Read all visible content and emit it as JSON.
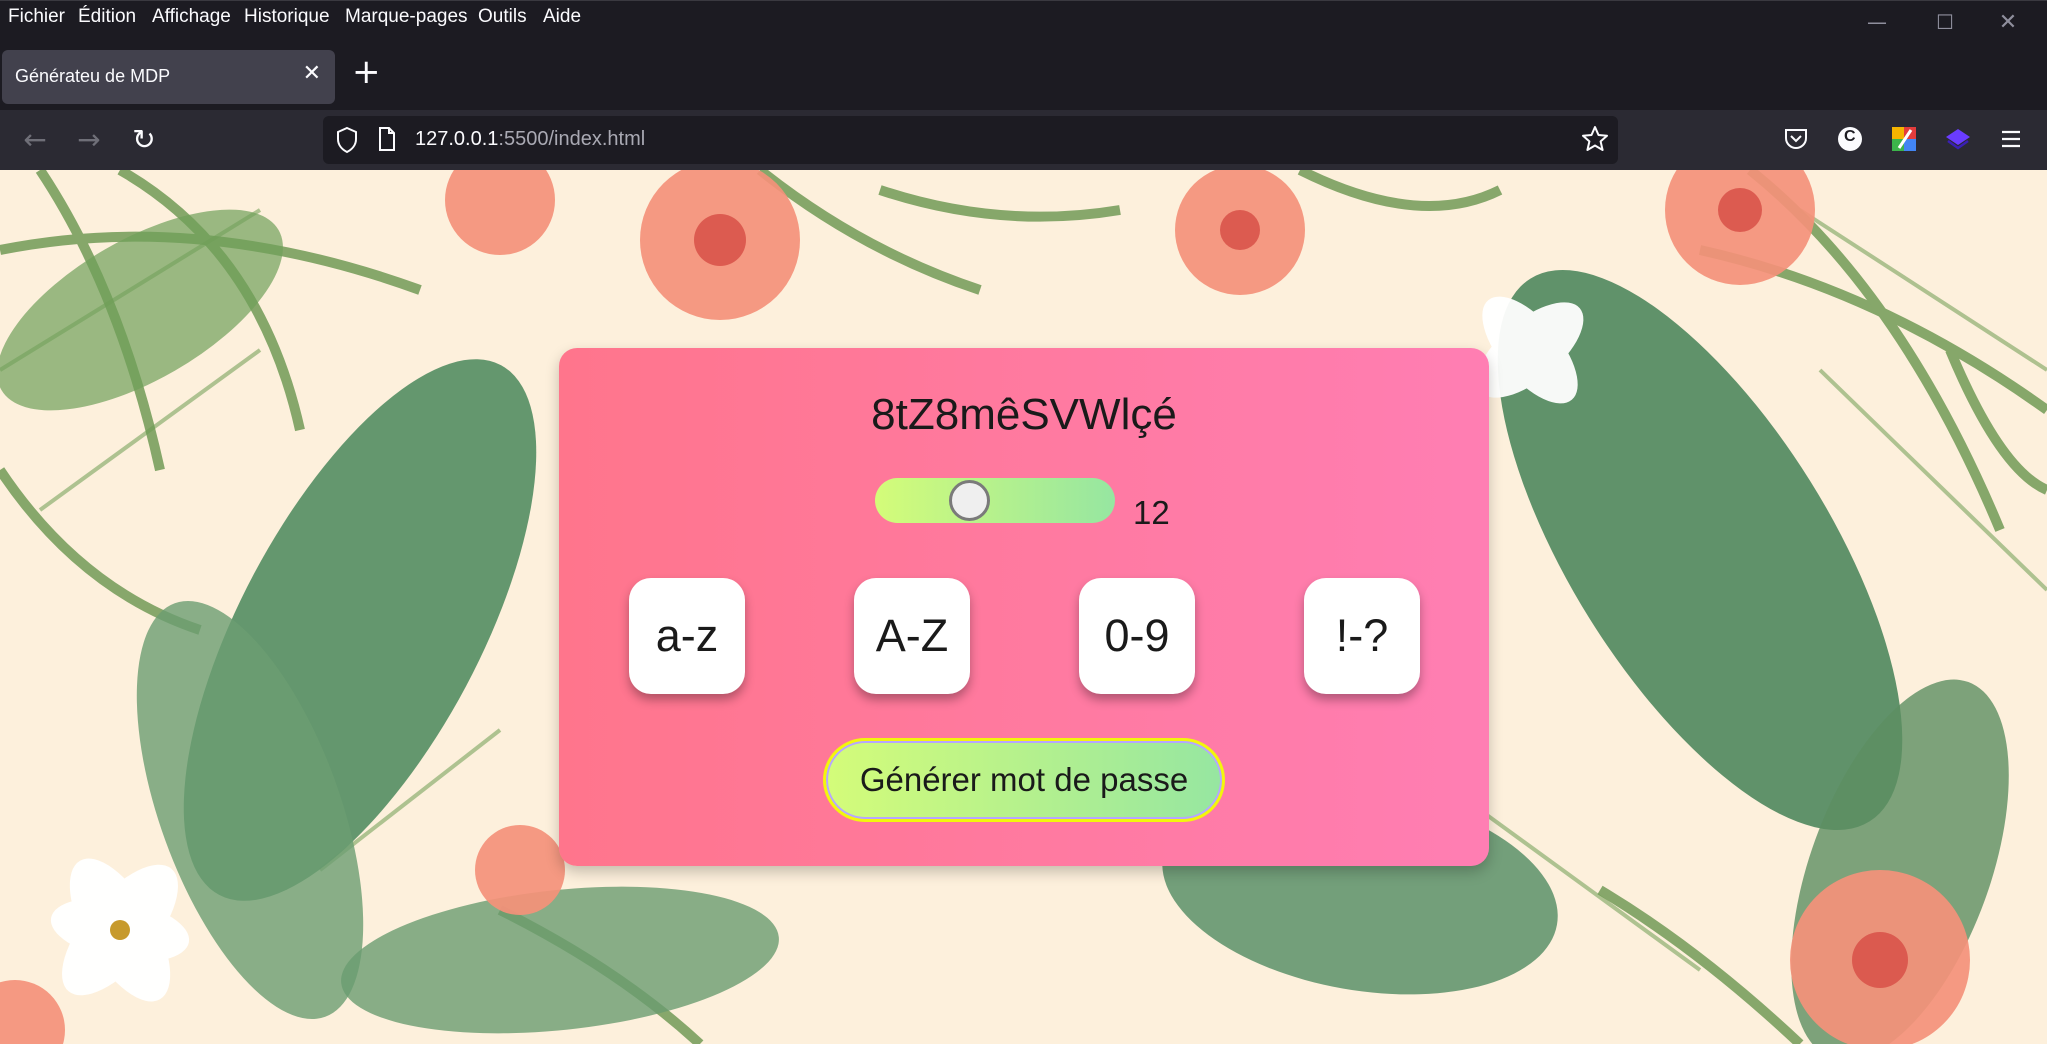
{
  "menubar": {
    "items": [
      "Fichier",
      "Édition",
      "Affichage",
      "Historique",
      "Marque-pages",
      "Outils",
      "Aide"
    ]
  },
  "window_controls": {
    "minimize": "—",
    "maximize": "☐",
    "close": "✕"
  },
  "tabs": [
    {
      "title": "Générateu de MDP",
      "active": true
    }
  ],
  "new_tab_label": "+",
  "toolbar": {
    "back_icon": "←",
    "forward_icon": "→",
    "reload_icon": "↻"
  },
  "urlbar": {
    "host": "127.0.0.1",
    "rest": ":5500/index.html"
  },
  "extensions": {
    "c_label": "C"
  },
  "app": {
    "password": "8tZ8mêSVWlçé",
    "length": "12",
    "length_min": 1,
    "length_max": 32,
    "options": [
      {
        "label": "a-z"
      },
      {
        "label": "A-Z"
      },
      {
        "label": "0-9"
      },
      {
        "label": "!-?"
      }
    ],
    "generate_label": "Générer mot de passe"
  },
  "colors": {
    "card_gradient": [
      "#ff758c",
      "#ff7eb3"
    ],
    "button_gradient": [
      "#d4fc79",
      "#96e6a1"
    ],
    "chrome_bg": "#1c1b22",
    "navbar_bg": "#2b2a33"
  }
}
